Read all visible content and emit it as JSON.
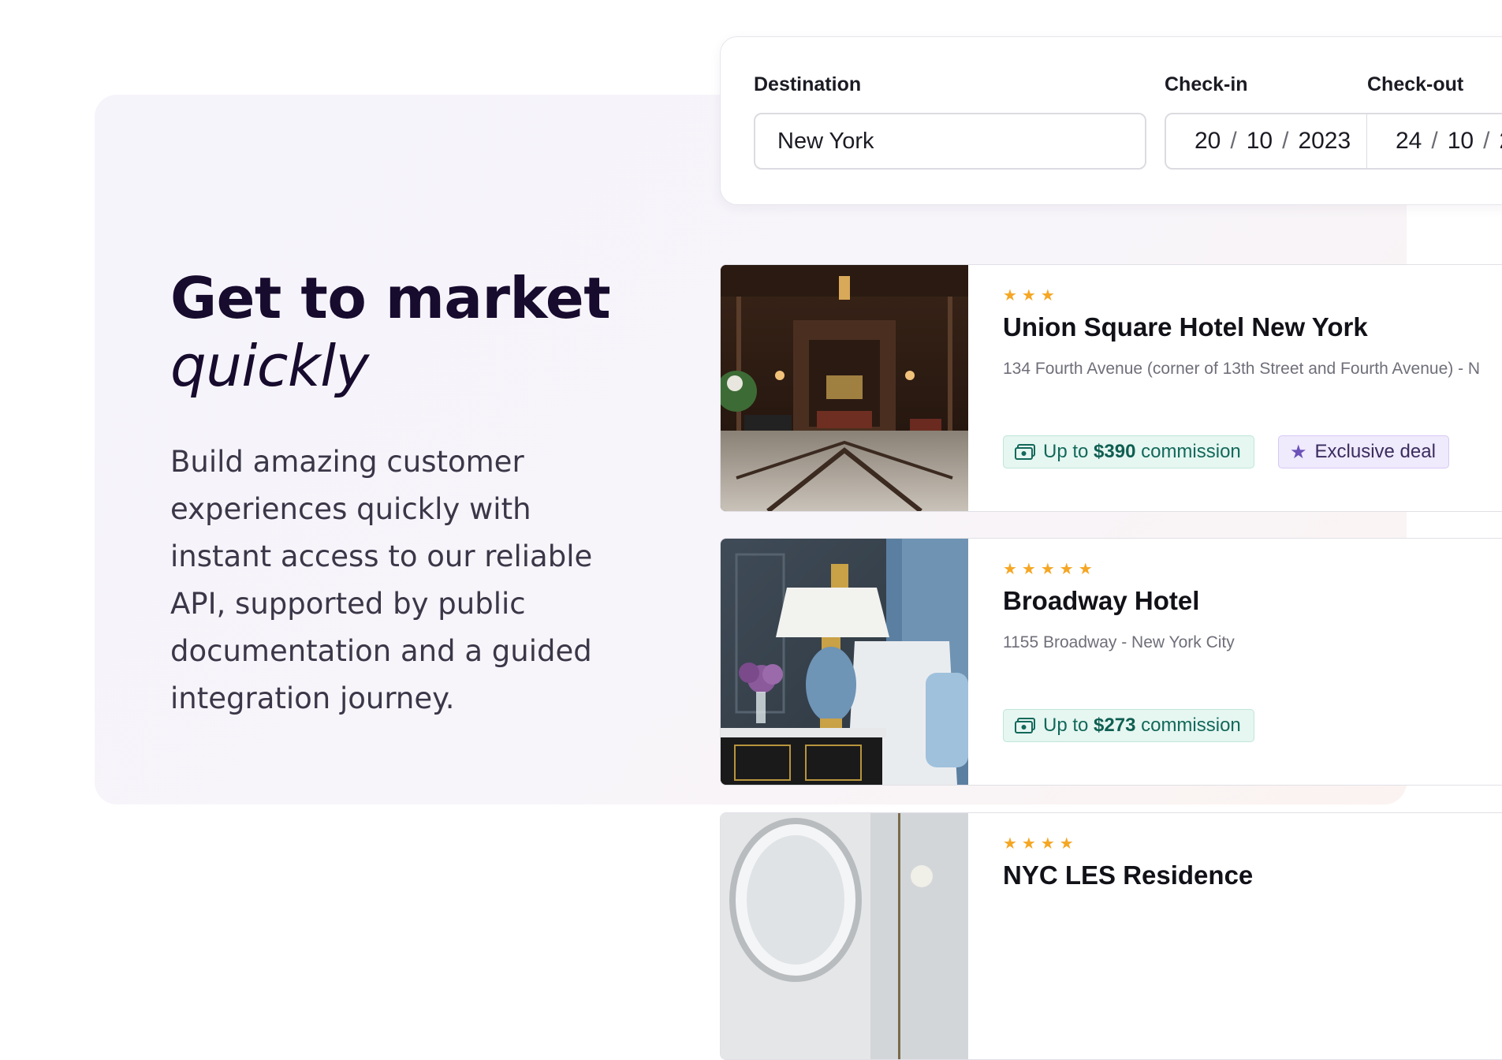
{
  "hero": {
    "headline_line1": "Get to market",
    "headline_line2": "quickly",
    "body": "Build amazing customer experiences quickly with instant access to our reliable API, supported by public documentation and a guided integration journey."
  },
  "search": {
    "destination_label": "Destination",
    "destination_value": "New York",
    "checkin_label": "Check-in",
    "checkin": {
      "day": "20",
      "month": "10",
      "year": "2023"
    },
    "checkout_label": "Check-out",
    "checkout": {
      "day": "24",
      "month": "10",
      "year": "2"
    },
    "date_separator": "/"
  },
  "hotels": [
    {
      "stars": "★★★",
      "name": "Union Square Hotel New York",
      "address": "134 Fourth Avenue (corner of 13th Street and Fourth Avenue) - N",
      "commission_prefix": "Up to ",
      "commission_amount": "$390",
      "commission_suffix": " commission",
      "deal": "Exclusive deal"
    },
    {
      "stars": "★★★★★",
      "name": "Broadway Hotel",
      "address": "1155 Broadway - New York City",
      "commission_prefix": "Up to ",
      "commission_amount": "$273",
      "commission_suffix": " commission"
    },
    {
      "stars": "★★★★",
      "name": "NYC LES Residence"
    }
  ],
  "colors": {
    "star": "#f5a623",
    "commission_bg": "#e6f6f1",
    "commission_text": "#12695a",
    "deal_bg": "#efeafc",
    "deal_text": "#3a2c5e",
    "headline": "#170b2e"
  },
  "icons": [
    "cash-icon",
    "star-icon"
  ]
}
